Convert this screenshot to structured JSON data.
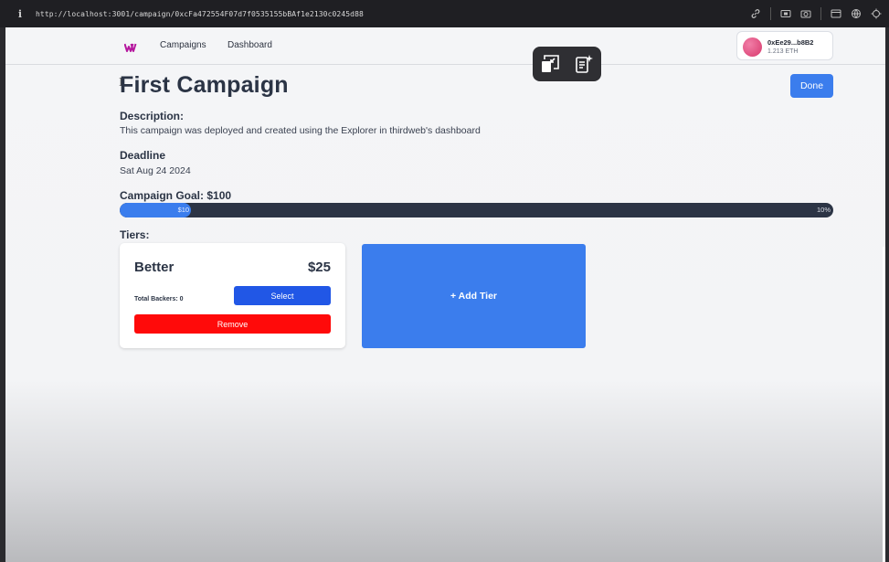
{
  "browser": {
    "info_icon": "i",
    "url": "http://localhost:3001/campaign/0xcFa472554F07d7f0535155bBAf1e2130c0245d88",
    "tool_icons": [
      "link-icon",
      "screenshot-icon",
      "camera-icon",
      "window-icon",
      "extension-icon",
      "target-icon"
    ]
  },
  "overlay": {
    "icons": [
      "exit-picture-in-picture-icon",
      "ai-notes-icon"
    ]
  },
  "navbar": {
    "logo_color": "#b5179e",
    "links": [
      "Campaigns",
      "Dashboard"
    ],
    "wallet": {
      "address": "0xEe29...b8B2",
      "balance": "1.213 ETH"
    }
  },
  "campaign": {
    "title": "First Campaign",
    "done_label": "Done",
    "description_label": "Description:",
    "description": "This campaign was deployed and created using the Explorer in thirdweb's dashboard",
    "deadline_label": "Deadline",
    "deadline": "Sat Aug 24 2024",
    "goal_label": "Campaign Goal: $100",
    "progress": {
      "fraction": 0.1,
      "raised_label": "$10",
      "percent_label": "10%"
    },
    "tiers_label": "Tiers:"
  },
  "tiers": [
    {
      "name": "Better",
      "price": "$25",
      "backers": "Total Backers: 0",
      "select_label": "Select",
      "remove_label": "Remove"
    }
  ],
  "add_tier_label": "+ Add Tier",
  "colors": {
    "accent": "#3b7ded",
    "select": "#2157e6",
    "remove": "#ff0a0a",
    "progress_track": "#2c3445"
  }
}
